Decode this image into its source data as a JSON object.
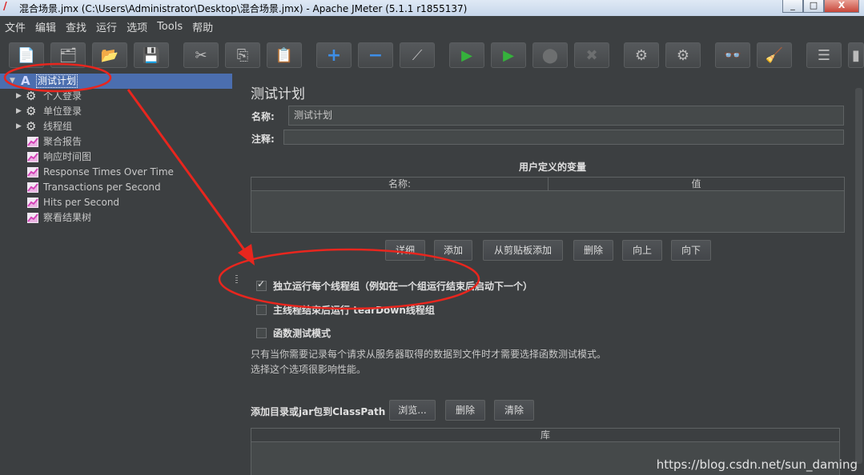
{
  "window": {
    "title": "混合场景.jmx (C:\\Users\\Administrator\\Desktop\\混合场景.jmx) - Apache JMeter (5.1.1 r1855137)",
    "buttons": [
      "_",
      "□",
      "X"
    ]
  },
  "menu": [
    "文件",
    "编辑",
    "查找",
    "运行",
    "选项",
    "Tools",
    "帮助"
  ],
  "toolbar": {
    "icons": [
      {
        "name": "new-icon",
        "glyph": "📄"
      },
      {
        "name": "templates-icon",
        "glyph": "🗂"
      },
      {
        "name": "open-icon",
        "glyph": "📂"
      },
      {
        "name": "save-icon",
        "glyph": "💾"
      },
      {
        "name": "cut-icon",
        "glyph": "✂"
      },
      {
        "name": "copy-icon",
        "glyph": "⎘"
      },
      {
        "name": "paste-icon",
        "glyph": "📋"
      },
      {
        "name": "expand-icon",
        "glyph": "+"
      },
      {
        "name": "collapse-icon",
        "glyph": "−"
      },
      {
        "name": "toggle-icon",
        "glyph": "⟋"
      },
      {
        "name": "start-icon",
        "glyph": "▶"
      },
      {
        "name": "start-no-pause-icon",
        "glyph": "▶"
      },
      {
        "name": "stop-icon",
        "glyph": "⬤"
      },
      {
        "name": "shutdown-icon",
        "glyph": "✖"
      },
      {
        "name": "clear-icon",
        "glyph": "⚙"
      },
      {
        "name": "clear-all-icon",
        "glyph": "⚙"
      },
      {
        "name": "search-icon",
        "glyph": "👓"
      },
      {
        "name": "reset-search-icon",
        "glyph": "🧹"
      },
      {
        "name": "function-helper-icon",
        "glyph": "☰"
      },
      {
        "name": "help-icon",
        "glyph": "▮"
      }
    ]
  },
  "tree": [
    {
      "label": "测试计划",
      "type": "plan",
      "selected": true,
      "arrow": "▼"
    },
    {
      "label": "个人登录",
      "type": "gear",
      "arrow": "▶"
    },
    {
      "label": "单位登录",
      "type": "gear",
      "arrow": "▶"
    },
    {
      "label": "线程组",
      "type": "gear",
      "arrow": "▶"
    },
    {
      "label": "聚合报告",
      "type": "chart"
    },
    {
      "label": "响应时间图",
      "type": "chart"
    },
    {
      "label": "Response Times Over Time",
      "type": "chart"
    },
    {
      "label": "Transactions per Second",
      "type": "chart"
    },
    {
      "label": "Hits per Second",
      "type": "chart"
    },
    {
      "label": "察看结果树",
      "type": "chart"
    }
  ],
  "panel": {
    "title": "测试计划",
    "name_label": "名称:",
    "name_value": "测试计划",
    "comment_label": "注释:",
    "comment_value": "",
    "vars_title": "用户定义的变量",
    "vars_columns": [
      "名称:",
      "值"
    ],
    "var_buttons": [
      "详细",
      "添加",
      "从剪贴板添加",
      "删除",
      "向上",
      "向下"
    ],
    "checkboxes": [
      {
        "label": "独立运行每个线程组（例如在一个组运行结束后启动下一个）",
        "checked": true
      },
      {
        "label": "主线程结束后运行 tearDown线程组",
        "checked": false
      },
      {
        "label": "函数测试模式",
        "checked": false
      }
    ],
    "info_lines": [
      "只有当你需要记录每个请求从服务器取得的数据到文件时才需要选择函数测试模式。",
      "选择这个选项很影响性能。"
    ],
    "classpath_label": "添加目录或jar包到ClassPath",
    "classpath_buttons": [
      "浏览...",
      "删除",
      "清除"
    ],
    "lib_column": "库"
  },
  "watermark": "https://blog.csdn.net/sun_daming",
  "annotation_color": "#e8261e"
}
